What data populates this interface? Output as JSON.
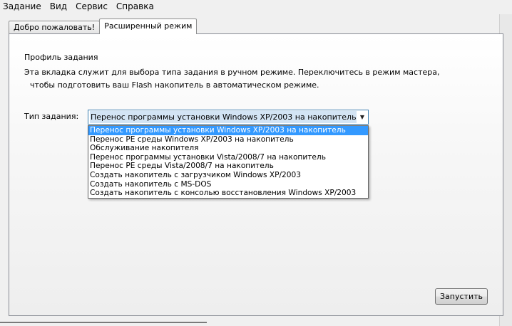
{
  "menu": {
    "items": [
      "Задание",
      "Вид",
      "Сервис",
      "Справка"
    ]
  },
  "tabs": [
    {
      "label": "Добро пожаловать!",
      "active": false
    },
    {
      "label": "Расширенный режим",
      "active": true
    }
  ],
  "profile": {
    "title": "Профиль задания",
    "description_line1": "Эта вкладка служит для выбора типа задания в ручном режиме. Переключитесь в режим мастера,",
    "description_line2": "чтобы подготовить ваш Flash накопитель в автоматическом режиме."
  },
  "task_type": {
    "label": "Тип задания:",
    "selected": "Перенос программы установки Windows XP/2003 на накопитель",
    "options": [
      "Перенос программы установки Windows XP/2003 на накопитель",
      "Перенос PE среды Windows XP/2003 на накопитель",
      "Обслуживание накопителя",
      "Перенос программы установки Vista/2008/7 на накопитель",
      "Перенос PE среды Vista/2008/7 на накопитель",
      "Создать накопитель с загрузчиком Windows XP/2003",
      "Создать накопитель с MS-DOS",
      "Создать накопитель с консолью восстановления Windows XP/2003"
    ],
    "highlighted_index": 0
  },
  "actions": {
    "run_label": "Запустить"
  },
  "colors": {
    "selection": "#3399ff",
    "select_border": "#3c7fb1",
    "window_bg": "#f0f0f0"
  }
}
